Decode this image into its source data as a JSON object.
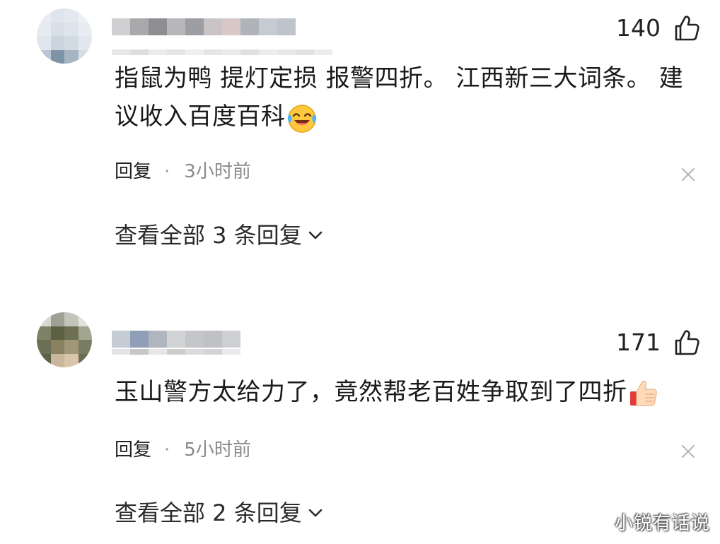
{
  "comments": [
    {
      "like_count": "140",
      "text_line1": "指鼠为鸭 提灯定损 报警四折。 江西新三大词条。 建",
      "text_line2": "议收入百度百科",
      "emoji": "laughing-crying-emoji",
      "reply_label": "回复",
      "separator": "·",
      "time": "3小时前",
      "view_replies": "查看全部 3 条回复"
    },
    {
      "like_count": "171",
      "text_line1": "玉山警方太给力了，竟然帮老百姓争取到了四折",
      "emoji": "thumbs-up-emoji",
      "reply_label": "回复",
      "separator": "·",
      "time": "5小时前",
      "view_replies": "查看全部 2 条回复"
    }
  ],
  "watermark": "小锐有话说",
  "icons": {
    "like": "thumbs-up-outline-icon",
    "close": "close-icon",
    "expand": "chevron-down-icon"
  },
  "colors": {
    "text": "#1a1a1a",
    "meta_time": "#8a8a8a",
    "icon_stroke": "#222222",
    "close_stroke": "#b5b5b5"
  }
}
